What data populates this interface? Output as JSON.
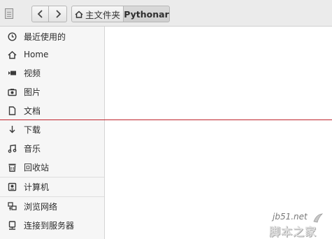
{
  "toolbar": {
    "sidebar_toggle_icon": "document-icon",
    "back_icon": "chevron-left-icon",
    "forward_icon": "chevron-right-icon",
    "breadcrumb": {
      "home_icon": "home-icon",
      "home_label": "主文件夹",
      "current_label": "Pythonar"
    }
  },
  "sidebar": {
    "items": [
      {
        "icon": "clock-icon",
        "label": "最近使用的"
      },
      {
        "icon": "home-icon",
        "label": "Home"
      },
      {
        "icon": "video-icon",
        "label": "视频"
      },
      {
        "icon": "camera-icon",
        "label": "图片"
      },
      {
        "icon": "document-icon",
        "label": "文档"
      },
      {
        "icon": "download-icon",
        "label": "下载"
      },
      {
        "icon": "music-icon",
        "label": "音乐"
      },
      {
        "icon": "trash-icon",
        "label": "回收站"
      },
      {
        "icon": "drive-icon",
        "label": "计算机"
      },
      {
        "icon": "network-icon",
        "label": "浏览网络"
      },
      {
        "icon": "server-icon",
        "label": "连接到服务器"
      }
    ]
  },
  "watermark": {
    "url": "jb51.net",
    "name": "脚本之家"
  },
  "colors": {
    "toolbar_bg": "#ebebeb",
    "sidebar_bg": "#f6f6f6",
    "divider_red": "#c0232c"
  }
}
